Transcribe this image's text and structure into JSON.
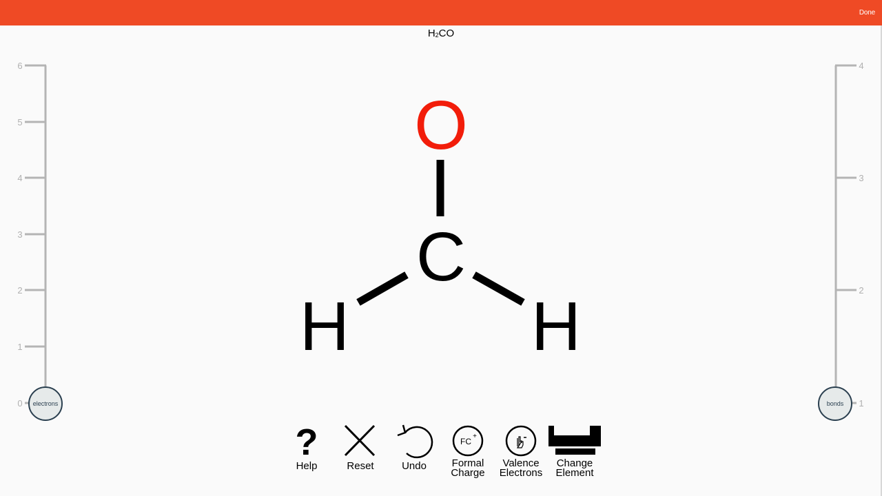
{
  "topbar": {
    "done_label": "Done",
    "color": "#ef4a25"
  },
  "formula": {
    "h": "H",
    "sub": "2",
    "rest": "CO"
  },
  "left_slider": {
    "ticks": [
      "0",
      "1",
      "2",
      "3",
      "4",
      "5",
      "6"
    ],
    "knob_label": "electrons",
    "value": 0
  },
  "right_slider": {
    "ticks": [
      "1",
      "2",
      "3",
      "4"
    ],
    "knob_label": "bonds",
    "value": 1
  },
  "molecule": {
    "oxygen": "O",
    "carbon": "C",
    "hydrogen_left": "H",
    "hydrogen_right": "H",
    "oxygen_color": "#f21d0a"
  },
  "toolbar": {
    "help": "Help",
    "reset": "Reset",
    "undo": "Undo",
    "formal_charge_1": "Formal",
    "formal_charge_2": "Charge",
    "formal_charge_icon": "FC",
    "valence_1": "Valence",
    "valence_2": "Electrons",
    "change_1": "Change",
    "change_2": "Element"
  }
}
